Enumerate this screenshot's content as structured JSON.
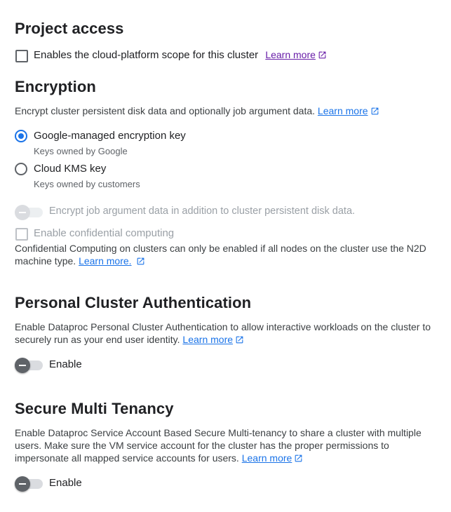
{
  "project_access": {
    "title": "Project access",
    "checkbox_label": "Enables the cloud-platform scope for this cluster",
    "learn_more": "Learn more"
  },
  "encryption": {
    "title": "Encryption",
    "description": "Encrypt cluster persistent disk data and optionally job argument data.",
    "learn_more": "Learn more",
    "options": [
      {
        "label": "Google-managed encryption key",
        "sublabel": "Keys owned by Google",
        "selected": true
      },
      {
        "label": "Cloud KMS key",
        "sublabel": "Keys owned by customers",
        "selected": false
      }
    ],
    "job_arg_toggle_label": "Encrypt job argument data in addition to cluster persistent disk data.",
    "confidential_label": "Enable confidential computing",
    "confidential_note_line1": "Confidential Computing on clusters can only be enabled if all nodes on the cluster use the N2D",
    "confidential_note_line2": "machine type.",
    "confidential_learn_more": "Learn more."
  },
  "personal_auth": {
    "title": "Personal Cluster Authentication",
    "description_line1": "Enable Dataproc Personal Cluster Authentication to allow interactive workloads on the cluster to",
    "description_line2": "securely run as your end user identity.",
    "learn_more": "Learn more",
    "toggle_label": "Enable"
  },
  "secure_multi_tenancy": {
    "title": "Secure Multi Tenancy",
    "description_line1": "Enable Dataproc Service Account Based Secure Multi-tenancy to share a cluster with multiple",
    "description_line2": "users. Make sure the VM service account for the cluster has the proper permissions to",
    "description_line3": "impersonate all mapped service accounts for users.",
    "learn_more": "Learn more",
    "toggle_label": "Enable"
  },
  "colors": {
    "link": "#1a73e8",
    "visited_link": "#681da8",
    "radio_selected": "#1a73e8",
    "text_primary": "#202124",
    "text_secondary": "#5f6368",
    "text_disabled": "#9aa0a6"
  },
  "icons": {
    "external_link": "open-in-new-icon"
  }
}
